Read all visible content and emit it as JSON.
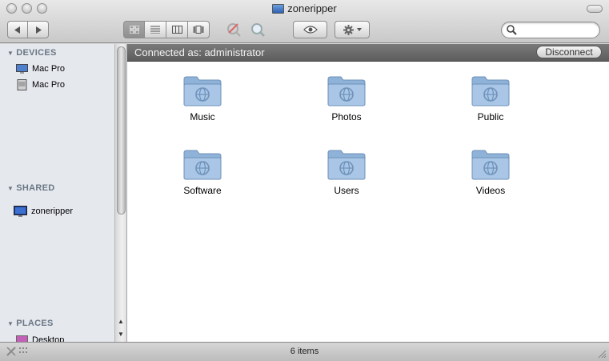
{
  "window": {
    "title": "zoneripper"
  },
  "toolbar": {
    "back_label": "◀",
    "forward_label": "▶",
    "views": [
      "icon-view",
      "list-view",
      "column-view",
      "coverflow-view"
    ],
    "search_placeholder": ""
  },
  "sidebar": {
    "devices_header": "DEVICES",
    "devices": [
      {
        "label": "Mac Pro",
        "icon": "computer-icon"
      },
      {
        "label": "Mac Pro",
        "icon": "harddisk-icon"
      }
    ],
    "shared_header": "SHARED",
    "shared": [
      {
        "label": "zoneripper",
        "icon": "monitor-icon"
      }
    ],
    "places_header": "PLACES",
    "places": [
      {
        "label": "Desktop",
        "icon": "desktop-icon"
      }
    ]
  },
  "connection": {
    "status": "Connected as: administrator",
    "disconnect_label": "Disconnect"
  },
  "folders": [
    {
      "label": "Music"
    },
    {
      "label": "Photos"
    },
    {
      "label": "Public"
    },
    {
      "label": "Software"
    },
    {
      "label": "Users"
    },
    {
      "label": "Videos"
    }
  ],
  "status": {
    "item_count": "6 items"
  },
  "colors": {
    "sidebar_bg": "#e5e9ee",
    "folder_blue": "#8fb3d8",
    "connect_bar": "#6b6b6b"
  }
}
